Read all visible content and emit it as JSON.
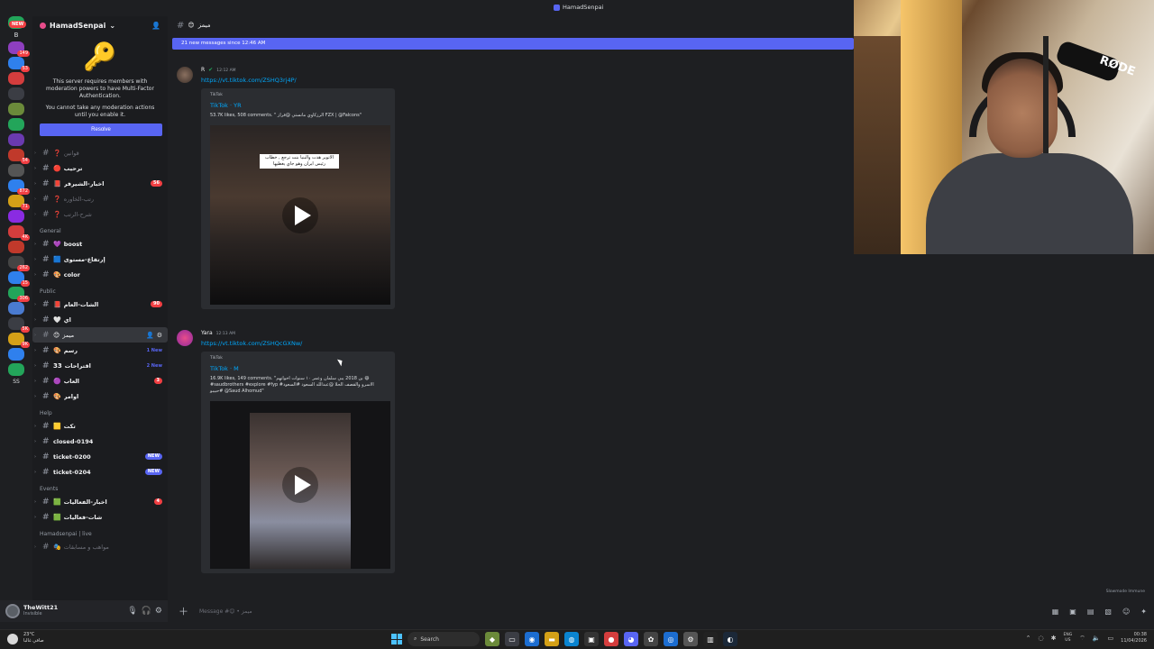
{
  "app": {
    "title": "HamadSenpai"
  },
  "rail": {
    "new_label": "NEW",
    "server_letter": "B",
    "items": [
      {
        "color": "#23a55a",
        "badge": ""
      },
      {
        "color": "#8e3fbf",
        "badge": "149"
      },
      {
        "color": "#2f80ed",
        "badge": "53"
      },
      {
        "color": "#d43d3d",
        "badge": ""
      },
      {
        "color": "#3b3d44",
        "badge": ""
      },
      {
        "color": "#6b8a3a",
        "badge": ""
      },
      {
        "color": "#23a55a",
        "badge": ""
      },
      {
        "color": "#6a3ab0",
        "badge": ""
      },
      {
        "color": "#c0392b",
        "badge": "54"
      },
      {
        "color": "#555",
        "badge": ""
      },
      {
        "color": "#2f80ed",
        "badge": "872"
      },
      {
        "color": "#d4a017",
        "badge": "71"
      },
      {
        "color": "#8a2be2",
        "badge": ""
      },
      {
        "color": "#d43d3d",
        "badge": "4K"
      },
      {
        "color": "#c0392b",
        "badge": ""
      },
      {
        "color": "#444",
        "badge": "262"
      },
      {
        "color": "#2f80ed",
        "badge": "15"
      },
      {
        "color": "#23a55a",
        "badge": "306"
      },
      {
        "color": "#4a7bd1",
        "badge": ""
      },
      {
        "color": "#3b3d44",
        "badge": "5K"
      },
      {
        "color": "#d4a017",
        "badge": "9K"
      },
      {
        "color": "#2f80ed",
        "badge": ""
      },
      {
        "color": "#23a55a",
        "badge": ""
      }
    ],
    "bottom_text": "SS"
  },
  "sidebar": {
    "server_name": "HamadSenpai",
    "chevron": "⌄",
    "mfa_notice": "This server requires members with moderation powers to have Multi-Factor Authentication.",
    "mfa_warning": "You cannot take any moderation actions until you enable it.",
    "resolve_label": "Resolve",
    "channels_top": [
      {
        "emoji": "❓",
        "name": "قوانين",
        "style": "dim",
        "badge": ""
      },
      {
        "emoji": "🔴",
        "name": "ترحيب",
        "style": "bright",
        "badge": ""
      },
      {
        "emoji": "📕",
        "name": "اخبار-الشيرفر",
        "style": "bright",
        "badge": "56"
      },
      {
        "emoji": "❓",
        "name": "رتب-الخاوره",
        "style": "dim",
        "badge": ""
      },
      {
        "emoji": "❓",
        "name": "شرح-الرتب",
        "style": "dim",
        "badge": ""
      }
    ],
    "cat_general": "General",
    "channels_general": [
      {
        "emoji": "💜",
        "name": "boost",
        "style": "bright",
        "badge": ""
      },
      {
        "emoji": "🟦",
        "name": "إرتفاع-مستوى",
        "style": "bright",
        "badge": ""
      },
      {
        "emoji": "🎨",
        "name": "color",
        "style": "bright",
        "badge": ""
      }
    ],
    "cat_public": "Public",
    "channels_public": [
      {
        "emoji": "📕",
        "name": "الشات-العام",
        "style": "bright",
        "badge": "90"
      },
      {
        "emoji": "🤍",
        "name": "اي",
        "style": "bright",
        "badge": ""
      },
      {
        "emoji": "😊",
        "name": "ميمز",
        "style": "sel",
        "badge": ""
      },
      {
        "emoji": "🎨",
        "name": "رسم",
        "style": "bright",
        "badge": "1 New"
      },
      {
        "emoji": "33",
        "name": "اقتراحات",
        "style": "bright",
        "badge": "2 New"
      },
      {
        "emoji": "🟣",
        "name": "العاب",
        "style": "bright",
        "badge": "3"
      },
      {
        "emoji": "🎨",
        "name": "اوامر",
        "style": "bright",
        "badge": ""
      }
    ],
    "cat_help": "Help",
    "channels_help": [
      {
        "emoji": "🟨",
        "name": "تكت",
        "style": "bright",
        "badge": ""
      },
      {
        "emoji": "",
        "name": "closed-0194",
        "style": "bright",
        "badge": ""
      },
      {
        "emoji": "",
        "name": "ticket-0200",
        "style": "bright",
        "badge": "NEW"
      },
      {
        "emoji": "",
        "name": "ticket-0204",
        "style": "bright",
        "badge": "NEW"
      }
    ],
    "cat_events": "Events",
    "channels_events": [
      {
        "emoji": "🟩",
        "name": "اخبار-الفعاليات",
        "style": "bright",
        "badge": "4"
      },
      {
        "emoji": "🟩",
        "name": "شات-فعاليات",
        "style": "bright",
        "badge": ""
      }
    ],
    "cat_live": "Hamadsenpai | live",
    "channels_live": [
      {
        "emoji": "🎭",
        "name": "مواهب و مسابقات",
        "style": "dim",
        "badge": ""
      }
    ]
  },
  "user": {
    "name": "TheWitt21",
    "status": "Invisible"
  },
  "channel": {
    "name": "ميمز",
    "emoji": "😊",
    "new_messages": "21 new messages since 12:46 AM"
  },
  "messages": [
    {
      "author": "R",
      "time": "12:12 AM",
      "link": "https://vt.tiktok.com/ZSHQ3rj4P/",
      "embed_provider": "TikTok",
      "embed_title": "TikTok · YR",
      "embed_desc": "53.7K likes, 508 comments. \" الرزكاوي مانستي @فراز FZX | @Falcons\"",
      "overlay_text": "الاتوبر هدت والبنيا بنت ترجع , خطاب رئيس ايران وهو جاي يغطيها"
    },
    {
      "author": "Yara",
      "time": "12:13 AM",
      "link": "https://vt.tiktok.com/ZSHQcGXNw/",
      "embed_provider": "TikTok",
      "embed_title": "TikTok · M",
      "embed_desc": "16.9K likes, 149 comments. \"بن 2018 يبي سلمان وعمر ١٠ سنوات اخواتهم 😄 #saudbrothers #explore #fyp #الاسرو والقصف الحلا @عبدالله السعود #السعود #حبيبو @Saud Alhomud\""
    }
  ],
  "composer": {
    "placeholder": "Message #😊 • ميمز"
  },
  "slowmode": "Slowmode Immune",
  "webcam": {
    "mic_brand": "RØDE"
  },
  "taskbar": {
    "weather_temp": "23°C",
    "weather_desc": "صافي غالبا",
    "search_placeholder": "Search",
    "lang_top": "ENG",
    "lang_bottom": "US",
    "time": "00:38",
    "date": "11/04/2026"
  }
}
